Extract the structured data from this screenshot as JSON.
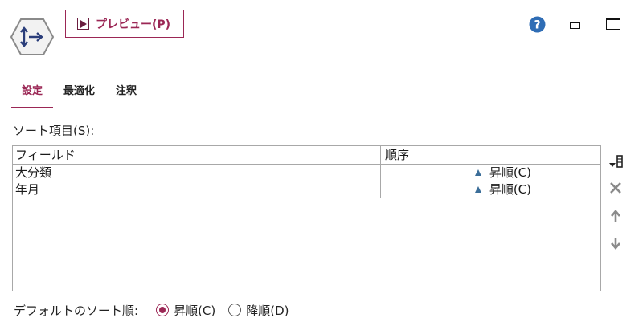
{
  "toolbar": {
    "preview_label": "プレビュー(P)"
  },
  "tabs": [
    {
      "label": "設定",
      "active": true
    },
    {
      "label": "最適化",
      "active": false
    },
    {
      "label": "注釈",
      "active": false
    }
  ],
  "sort": {
    "label": "ソート項目(S):",
    "columns": [
      "フィールド",
      "順序"
    ],
    "rows": [
      {
        "field": "大分類",
        "order": "昇順(C)"
      },
      {
        "field": "年月",
        "order": "昇順(C)"
      }
    ]
  },
  "default_order": {
    "label": "デフォルトのソート順:",
    "options": [
      "昇順(C)",
      "降順(D)"
    ],
    "selected": "昇順(C)"
  },
  "colors": {
    "accent": "#9b2755",
    "help": "#2f6db5",
    "ascending_marker": "#3b6e99"
  },
  "icons": [
    "sort-node-icon",
    "play-icon",
    "help-icon",
    "minimize-icon",
    "maximize-icon",
    "add-field-icon",
    "delete-icon",
    "move-up-icon",
    "move-down-icon"
  ]
}
